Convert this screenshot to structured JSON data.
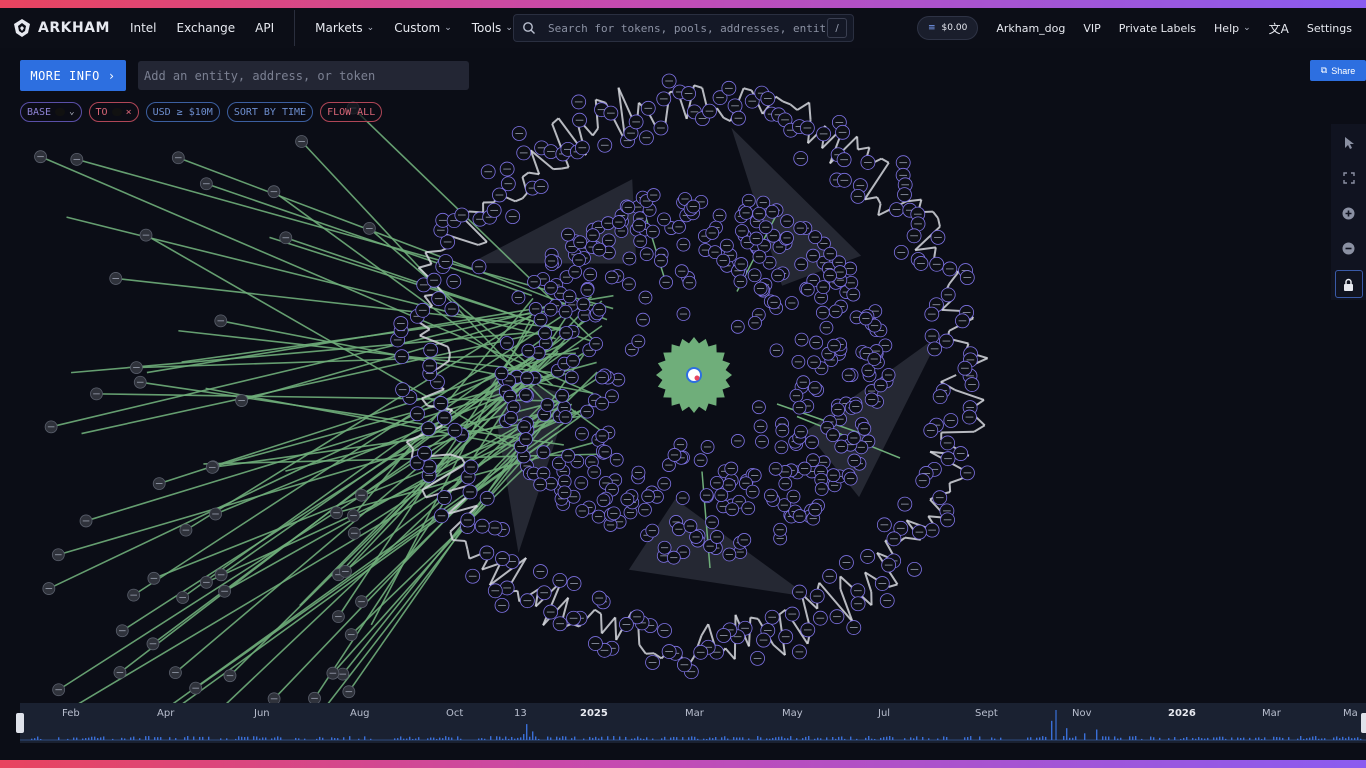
{
  "app": {
    "brand": "ARKHAM"
  },
  "nav": {
    "links": [
      "Intel",
      "Exchange",
      "API"
    ],
    "dropdowns": [
      "Markets",
      "Custom",
      "Tools"
    ],
    "search_placeholder": "Search for tokens, pools, addresses, entiti…",
    "search_shortcut": "/",
    "balance": "$0.00",
    "user": "Arkham_dog",
    "vip": "VIP",
    "private_labels": "Private Labels",
    "help": "Help",
    "settings": "Settings"
  },
  "toolbar": {
    "more_info": "MORE INFO",
    "add_placeholder": "Add an entity, address, or token",
    "share": "Share"
  },
  "filters": {
    "base": "BASE",
    "to": "TO",
    "usd": "USD ≥ $10M",
    "sort": "SORT BY TIME",
    "flow": "FLOW ALL"
  },
  "tools": [
    "pointer-icon",
    "fit-screen-icon",
    "zoom-in-icon",
    "zoom-out-icon",
    "lock-icon"
  ],
  "timeline": {
    "labels": [
      {
        "text": "Feb",
        "year": false
      },
      {
        "text": "Apr",
        "year": false
      },
      {
        "text": "Jun",
        "year": false
      },
      {
        "text": "Aug",
        "year": false
      },
      {
        "text": "Oct",
        "year": false
      },
      {
        "text": "13",
        "year": false
      },
      {
        "text": "2025",
        "year": true
      },
      {
        "text": "Mar",
        "year": false
      },
      {
        "text": "May",
        "year": false
      },
      {
        "text": "Jul",
        "year": false
      },
      {
        "text": "Sept",
        "year": false
      },
      {
        "text": "Nov",
        "year": false
      },
      {
        "text": "2026",
        "year": true
      },
      {
        "text": "Mar",
        "year": false
      },
      {
        "text": "Ma",
        "year": false
      }
    ]
  },
  "colors": {
    "edge_green": "#6fae7a",
    "edge_white": "#d6d8de",
    "node_fill": "#0d0f16",
    "node_stroke": "#7f73e6",
    "accent_blue": "#2d6fe0",
    "pentagon": "#272a35"
  }
}
